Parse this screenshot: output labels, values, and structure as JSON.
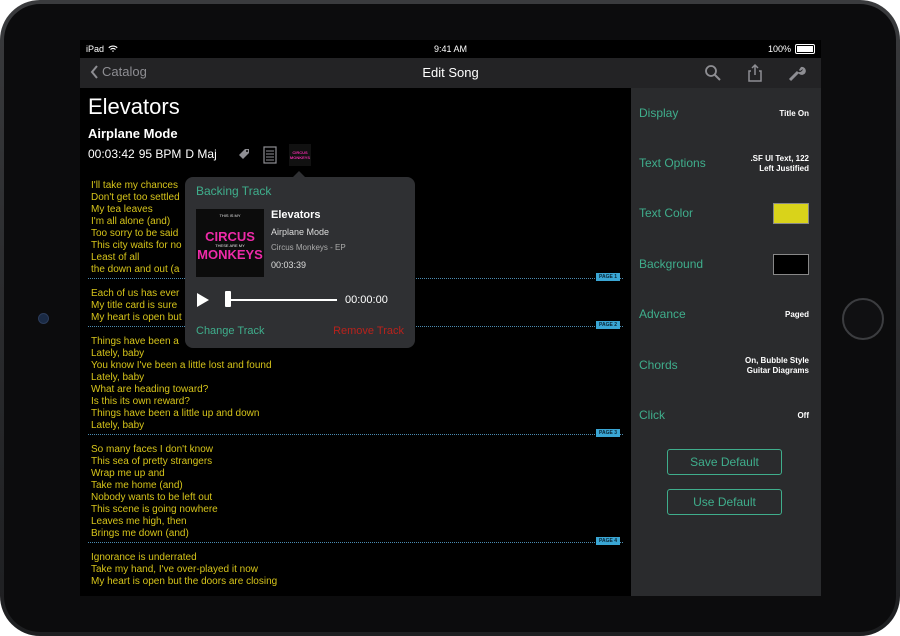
{
  "status": {
    "device": "iPad",
    "time": "9:41 AM",
    "battery": "100%"
  },
  "nav": {
    "back_label": "Catalog",
    "title": "Edit Song",
    "icons": [
      "search-icon",
      "share-icon",
      "wrench-icon"
    ]
  },
  "song": {
    "title": "Elevators",
    "subtitle": "Airplane Mode",
    "duration": "00:03:42",
    "bpm": "95 BPM",
    "key": "D Maj"
  },
  "lyrics": [
    "I'll take my chances",
    "Don't get too settled",
    "My tea leaves",
    "I'm all alone (and)",
    "Too sorry to be said",
    "This city waits for no",
    "Least of all",
    "the down and out (a",
    {
      "page": "PAGE 1"
    },
    "Each of us has ever",
    "My title card is sure",
    "My heart is open but",
    {
      "page": "PAGE 2"
    },
    "Things have been a",
    "Lately, baby",
    "You know I've been a little lost and found",
    "Lately, baby",
    "What are heading toward?",
    "Is this its own reward?",
    "Things have been a little up and down",
    "Lately, baby",
    {
      "page": "PAGE 3"
    },
    "So many faces I don't know",
    "This sea of pretty strangers",
    "Wrap me up and",
    "Take me home (and)",
    "Nobody wants to be left out",
    "This scene is going nowhere",
    "Leaves me high, then",
    "Brings me down (and)",
    {
      "page": "PAGE 4"
    },
    "Ignorance is underrated",
    "Take my hand, I've over-played it now",
    "My heart is open but the doors are closing"
  ],
  "settings": {
    "display": {
      "label": "Display",
      "value": "Title On"
    },
    "text_options": {
      "label": "Text Options",
      "value1": ".SF UI Text, 122",
      "value2": "Left Justified"
    },
    "text_color": {
      "label": "Text Color",
      "color": "#d9d31a"
    },
    "background": {
      "label": "Background",
      "color": "#000000"
    },
    "advance": {
      "label": "Advance",
      "value": "Paged"
    },
    "chords": {
      "label": "Chords",
      "value1": "On, Bubble Style",
      "value2": "Guitar Diagrams"
    },
    "click": {
      "label": "Click",
      "value": "Off"
    },
    "save_default": "Save Default",
    "use_default": "Use Default"
  },
  "popover": {
    "title": "Backing Track",
    "song": "Elevators",
    "subtitle": "Airplane Mode",
    "album": "Circus Monkeys - EP",
    "duration": "00:03:39",
    "position": "00:00:00",
    "progress": 0,
    "change_label": "Change Track",
    "remove_label": "Remove Track",
    "album_art": {
      "line1": "THIS IS MY",
      "line2": "CIRCUS",
      "line3": "THESE ARE MY",
      "line4": "MONKEYS"
    }
  },
  "colors": {
    "accent": "#3fae8c",
    "lyric": "#d6c41a",
    "danger": "#b9221c",
    "page_badge": "#3aa6d4"
  }
}
